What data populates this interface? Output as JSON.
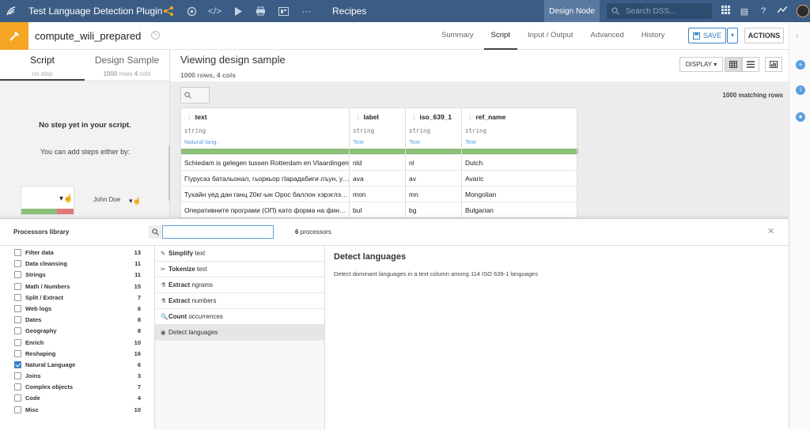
{
  "topbar": {
    "project_title": "Test Language Detection Plugin",
    "nav_label": "Recipes",
    "design_node": "Design Node",
    "search_placeholder": "Search DSS..."
  },
  "recipe": {
    "name": "compute_wili_prepared",
    "tabs": [
      "Summary",
      "Script",
      "Input / Output",
      "Advanced",
      "History"
    ],
    "active_tab": "Script",
    "save_label": "SAVE",
    "actions_label": "ACTIONS"
  },
  "left_panel": {
    "tab_script": "Script",
    "tab_script_sub": "no step",
    "tab_design": "Design Sample",
    "tab_design_sub_rows": "1000",
    "tab_design_sub_rows_label": "rows",
    "tab_design_sub_cols": "4",
    "tab_design_sub_cols_label": "cols",
    "no_step": "No step yet in your script.",
    "add_steps": "You can add steps either by:",
    "user": "John Doe"
  },
  "sample": {
    "title": "Viewing design sample",
    "rows": "1000 rows,",
    "cols": "4 cols",
    "display_label": "DISPLAY",
    "matching": "1000 matching rows"
  },
  "columns": [
    {
      "name": "text",
      "type": "string",
      "meaning": "Natural lang."
    },
    {
      "name": "label",
      "type": "string",
      "meaning": "Text"
    },
    {
      "name": "iso_639_1",
      "type": "string",
      "meaning": "Text"
    },
    {
      "name": "ref_name",
      "type": "string",
      "meaning": "Text"
    }
  ],
  "rows": [
    [
      "Schiedam is gelegen tussen Rotterdam en Vlaardingen",
      "nld",
      "nl",
      "Dutch"
    ],
    [
      "Гїурусаз батальонал, гьоркьор гІарадабиги лъун, у…",
      "ava",
      "av",
      "Avaric"
    ],
    [
      "Тухайн үед дан ганц 20кг-ын Орос баллон хэрэглэ…",
      "mon",
      "mn",
      "Mongolian"
    ],
    [
      "Оперативните програми (ОП) като форма на финансиране",
      "bul",
      "bg",
      "Bulgarian"
    ]
  ],
  "library": {
    "title": "Processors library",
    "count": "6",
    "count_label": "processors",
    "categories": [
      {
        "name": "Filter data",
        "count": "13",
        "checked": false
      },
      {
        "name": "Data cleansing",
        "count": "11",
        "checked": false
      },
      {
        "name": "Strings",
        "count": "11",
        "checked": false
      },
      {
        "name": "Math / Numbers",
        "count": "15",
        "checked": false
      },
      {
        "name": "Split / Extract",
        "count": "7",
        "checked": false
      },
      {
        "name": "Web logs",
        "count": "6",
        "checked": false
      },
      {
        "name": "Dates",
        "count": "8",
        "checked": false
      },
      {
        "name": "Geography",
        "count": "8",
        "checked": false
      },
      {
        "name": "Enrich",
        "count": "10",
        "checked": false
      },
      {
        "name": "Reshaping",
        "count": "16",
        "checked": false
      },
      {
        "name": "Natural Language",
        "count": "6",
        "checked": true
      },
      {
        "name": "Joins",
        "count": "3",
        "checked": false
      },
      {
        "name": "Complex objects",
        "count": "7",
        "checked": false
      },
      {
        "name": "Code",
        "count": "4",
        "checked": false
      },
      {
        "name": "Misc",
        "count": "10",
        "checked": false
      }
    ],
    "processors": [
      {
        "bold": "Simplify",
        "rest": " text",
        "icon": "✎"
      },
      {
        "bold": "Tokenize",
        "rest": " text",
        "icon": "✂"
      },
      {
        "bold": "Extract",
        "rest": " ngrams",
        "icon": "⚗"
      },
      {
        "bold": "Extract",
        "rest": " numbers",
        "icon": "⚗"
      },
      {
        "bold": "Count",
        "rest": " occurrences",
        "icon": "🔍"
      },
      {
        "bold": "",
        "rest": "Detect languages",
        "icon": "◉"
      }
    ],
    "selected_processor": 5,
    "detail_title": "Detect languages",
    "detail_desc": "Detect dominant languages in a text column among 114 ISO 639-1 languages"
  }
}
